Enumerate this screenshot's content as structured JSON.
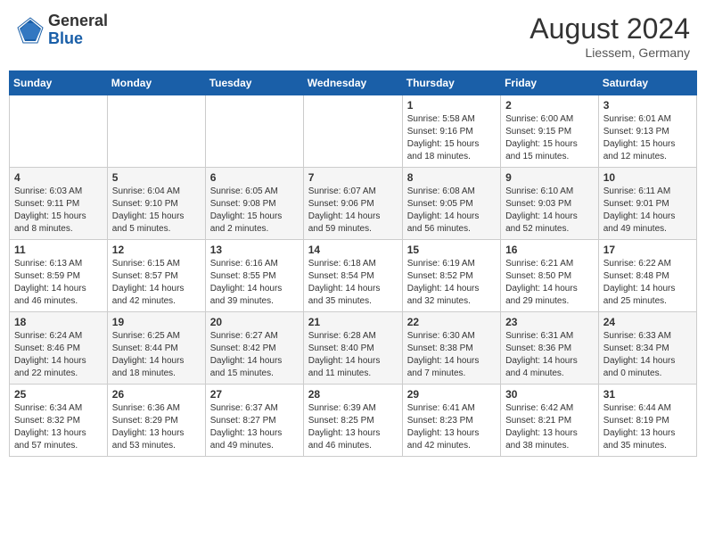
{
  "header": {
    "logo": {
      "general": "General",
      "blue": "Blue"
    },
    "title": "August 2024",
    "location": "Liessem, Germany"
  },
  "weekdays": [
    "Sunday",
    "Monday",
    "Tuesday",
    "Wednesday",
    "Thursday",
    "Friday",
    "Saturday"
  ],
  "weeks": [
    [
      {
        "day": "",
        "info": ""
      },
      {
        "day": "",
        "info": ""
      },
      {
        "day": "",
        "info": ""
      },
      {
        "day": "",
        "info": ""
      },
      {
        "day": "1",
        "info": "Sunrise: 5:58 AM\nSunset: 9:16 PM\nDaylight: 15 hours\nand 18 minutes."
      },
      {
        "day": "2",
        "info": "Sunrise: 6:00 AM\nSunset: 9:15 PM\nDaylight: 15 hours\nand 15 minutes."
      },
      {
        "day": "3",
        "info": "Sunrise: 6:01 AM\nSunset: 9:13 PM\nDaylight: 15 hours\nand 12 minutes."
      }
    ],
    [
      {
        "day": "4",
        "info": "Sunrise: 6:03 AM\nSunset: 9:11 PM\nDaylight: 15 hours\nand 8 minutes."
      },
      {
        "day": "5",
        "info": "Sunrise: 6:04 AM\nSunset: 9:10 PM\nDaylight: 15 hours\nand 5 minutes."
      },
      {
        "day": "6",
        "info": "Sunrise: 6:05 AM\nSunset: 9:08 PM\nDaylight: 15 hours\nand 2 minutes."
      },
      {
        "day": "7",
        "info": "Sunrise: 6:07 AM\nSunset: 9:06 PM\nDaylight: 14 hours\nand 59 minutes."
      },
      {
        "day": "8",
        "info": "Sunrise: 6:08 AM\nSunset: 9:05 PM\nDaylight: 14 hours\nand 56 minutes."
      },
      {
        "day": "9",
        "info": "Sunrise: 6:10 AM\nSunset: 9:03 PM\nDaylight: 14 hours\nand 52 minutes."
      },
      {
        "day": "10",
        "info": "Sunrise: 6:11 AM\nSunset: 9:01 PM\nDaylight: 14 hours\nand 49 minutes."
      }
    ],
    [
      {
        "day": "11",
        "info": "Sunrise: 6:13 AM\nSunset: 8:59 PM\nDaylight: 14 hours\nand 46 minutes."
      },
      {
        "day": "12",
        "info": "Sunrise: 6:15 AM\nSunset: 8:57 PM\nDaylight: 14 hours\nand 42 minutes."
      },
      {
        "day": "13",
        "info": "Sunrise: 6:16 AM\nSunset: 8:55 PM\nDaylight: 14 hours\nand 39 minutes."
      },
      {
        "day": "14",
        "info": "Sunrise: 6:18 AM\nSunset: 8:54 PM\nDaylight: 14 hours\nand 35 minutes."
      },
      {
        "day": "15",
        "info": "Sunrise: 6:19 AM\nSunset: 8:52 PM\nDaylight: 14 hours\nand 32 minutes."
      },
      {
        "day": "16",
        "info": "Sunrise: 6:21 AM\nSunset: 8:50 PM\nDaylight: 14 hours\nand 29 minutes."
      },
      {
        "day": "17",
        "info": "Sunrise: 6:22 AM\nSunset: 8:48 PM\nDaylight: 14 hours\nand 25 minutes."
      }
    ],
    [
      {
        "day": "18",
        "info": "Sunrise: 6:24 AM\nSunset: 8:46 PM\nDaylight: 14 hours\nand 22 minutes."
      },
      {
        "day": "19",
        "info": "Sunrise: 6:25 AM\nSunset: 8:44 PM\nDaylight: 14 hours\nand 18 minutes."
      },
      {
        "day": "20",
        "info": "Sunrise: 6:27 AM\nSunset: 8:42 PM\nDaylight: 14 hours\nand 15 minutes."
      },
      {
        "day": "21",
        "info": "Sunrise: 6:28 AM\nSunset: 8:40 PM\nDaylight: 14 hours\nand 11 minutes."
      },
      {
        "day": "22",
        "info": "Sunrise: 6:30 AM\nSunset: 8:38 PM\nDaylight: 14 hours\nand 7 minutes."
      },
      {
        "day": "23",
        "info": "Sunrise: 6:31 AM\nSunset: 8:36 PM\nDaylight: 14 hours\nand 4 minutes."
      },
      {
        "day": "24",
        "info": "Sunrise: 6:33 AM\nSunset: 8:34 PM\nDaylight: 14 hours\nand 0 minutes."
      }
    ],
    [
      {
        "day": "25",
        "info": "Sunrise: 6:34 AM\nSunset: 8:32 PM\nDaylight: 13 hours\nand 57 minutes."
      },
      {
        "day": "26",
        "info": "Sunrise: 6:36 AM\nSunset: 8:29 PM\nDaylight: 13 hours\nand 53 minutes."
      },
      {
        "day": "27",
        "info": "Sunrise: 6:37 AM\nSunset: 8:27 PM\nDaylight: 13 hours\nand 49 minutes."
      },
      {
        "day": "28",
        "info": "Sunrise: 6:39 AM\nSunset: 8:25 PM\nDaylight: 13 hours\nand 46 minutes."
      },
      {
        "day": "29",
        "info": "Sunrise: 6:41 AM\nSunset: 8:23 PM\nDaylight: 13 hours\nand 42 minutes."
      },
      {
        "day": "30",
        "info": "Sunrise: 6:42 AM\nSunset: 8:21 PM\nDaylight: 13 hours\nand 38 minutes."
      },
      {
        "day": "31",
        "info": "Sunrise: 6:44 AM\nSunset: 8:19 PM\nDaylight: 13 hours\nand 35 minutes."
      }
    ]
  ]
}
